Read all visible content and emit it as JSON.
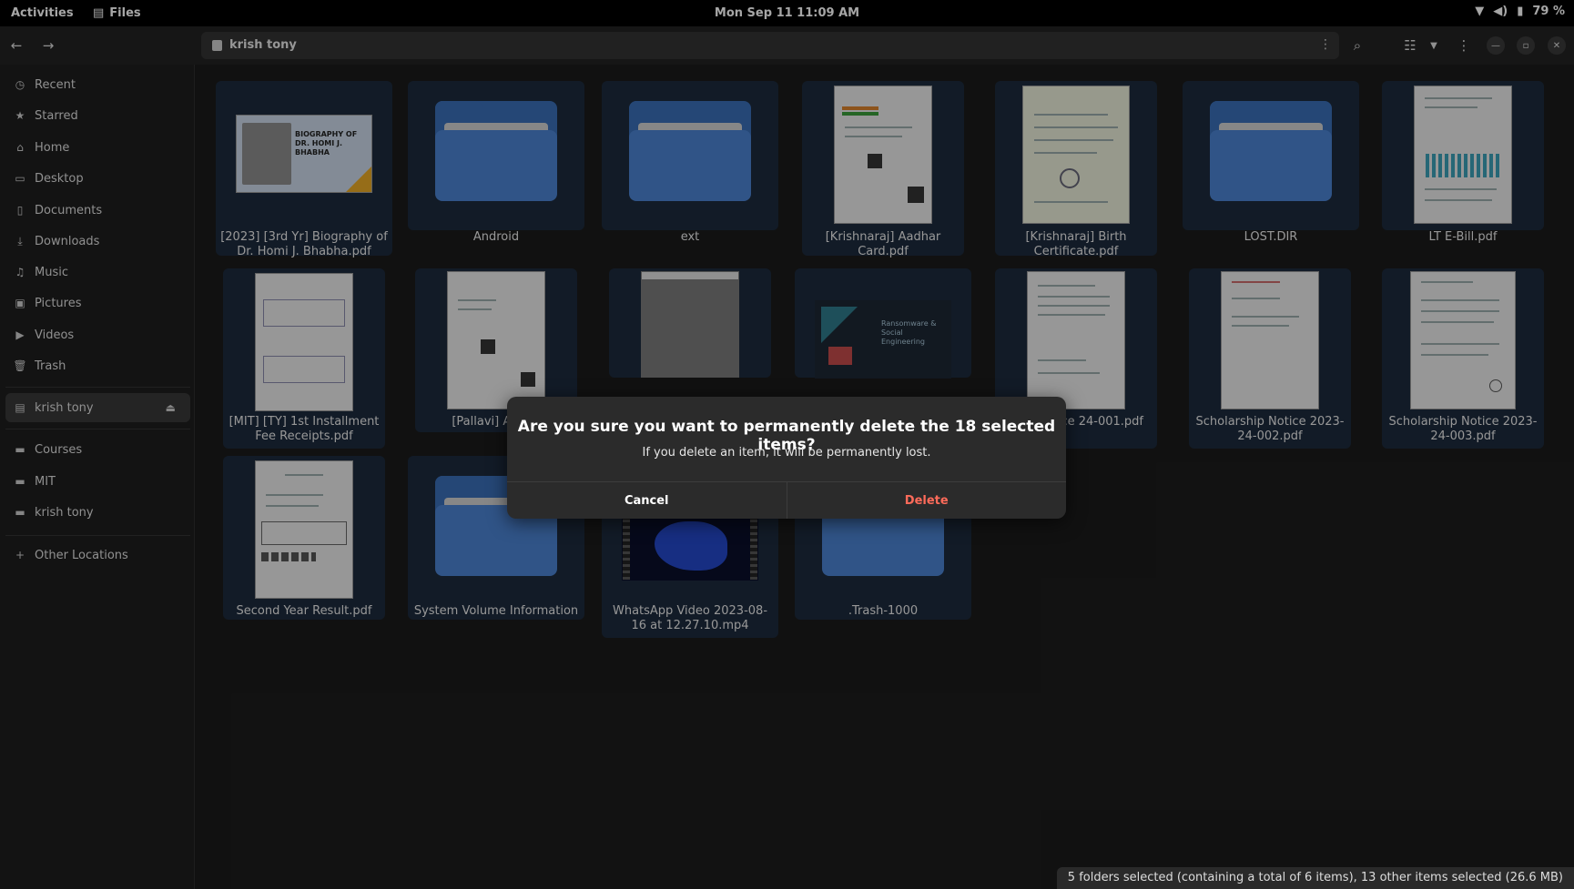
{
  "topbar": {
    "activities": "Activities",
    "app_name": "Files",
    "clock": "Mon Sep 11  11:09 AM",
    "battery": "79 %"
  },
  "header": {
    "location": "krish tony"
  },
  "sidebar": {
    "items": [
      {
        "label": "Recent",
        "icon": "clock-icon"
      },
      {
        "label": "Starred",
        "icon": "star-icon"
      },
      {
        "label": "Home",
        "icon": "home-icon"
      },
      {
        "label": "Desktop",
        "icon": "desktop-icon"
      },
      {
        "label": "Documents",
        "icon": "document-icon"
      },
      {
        "label": "Downloads",
        "icon": "download-icon"
      },
      {
        "label": "Music",
        "icon": "music-icon"
      },
      {
        "label": "Pictures",
        "icon": "picture-icon"
      },
      {
        "label": "Videos",
        "icon": "video-icon"
      },
      {
        "label": "Trash",
        "icon": "trash-icon"
      }
    ],
    "device": "krish tony",
    "bookmarks": [
      "Courses",
      "MIT",
      "krish tony"
    ],
    "other_locations": "Other Locations"
  },
  "files": [
    {
      "name": "[2023] [3rd Yr] Biography of Dr. Homi J. Bhabha.pdf",
      "kind": "pdf-cover"
    },
    {
      "name": "Android",
      "kind": "folder"
    },
    {
      "name": "ext",
      "kind": "folder"
    },
    {
      "name": "[Krishnaraj] Aadhar Card.pdf",
      "kind": "pdf"
    },
    {
      "name": "[Krishnaraj] Birth Certificate.pdf",
      "kind": "pdf"
    },
    {
      "name": "LOST.DIR",
      "kind": "folder"
    },
    {
      "name": "LT E-Bill.pdf",
      "kind": "pdf"
    },
    {
      "name": "[MIT] [TY] 1st Installment Fee Receipts.pdf",
      "kind": "pdf"
    },
    {
      "name": "[Pallavi] Aadha",
      "kind": "pdf"
    },
    {
      "name": "",
      "kind": "image"
    },
    {
      "name": "",
      "kind": "slide"
    },
    {
      "name": "ship Notice\n24-001.pdf",
      "kind": "pdf"
    },
    {
      "name": "Scholarship Notice 2023-24-002.pdf",
      "kind": "pdf"
    },
    {
      "name": "Scholarship Notice 2023-24-003.pdf",
      "kind": "pdf"
    },
    {
      "name": "Second Year Result.pdf",
      "kind": "pdf"
    },
    {
      "name": "System Volume Information",
      "kind": "folder"
    },
    {
      "name": "WhatsApp Video 2023-08-16 at 12.27.10.mp4",
      "kind": "video"
    },
    {
      "name": ".Trash-1000",
      "kind": "folder"
    }
  ],
  "thumb_text": {
    "bio_cover": "BIOGRAPHY OF DR. HOMI J. BHABHA",
    "slide": "Ransomware & Social Engineering"
  },
  "dialog": {
    "title": "Are you sure you want to permanently delete the 18 selected items?",
    "body": "If you delete an item, it will be permanently lost.",
    "cancel": "Cancel",
    "delete": "Delete"
  },
  "status": "5 folders selected (containing a total of 6 items), 13 other items selected (26.6 MB)",
  "colors": {
    "accent_folder": "#4a82cf",
    "selection": "#1c2a3c",
    "destructive": "#ff6b5a"
  }
}
